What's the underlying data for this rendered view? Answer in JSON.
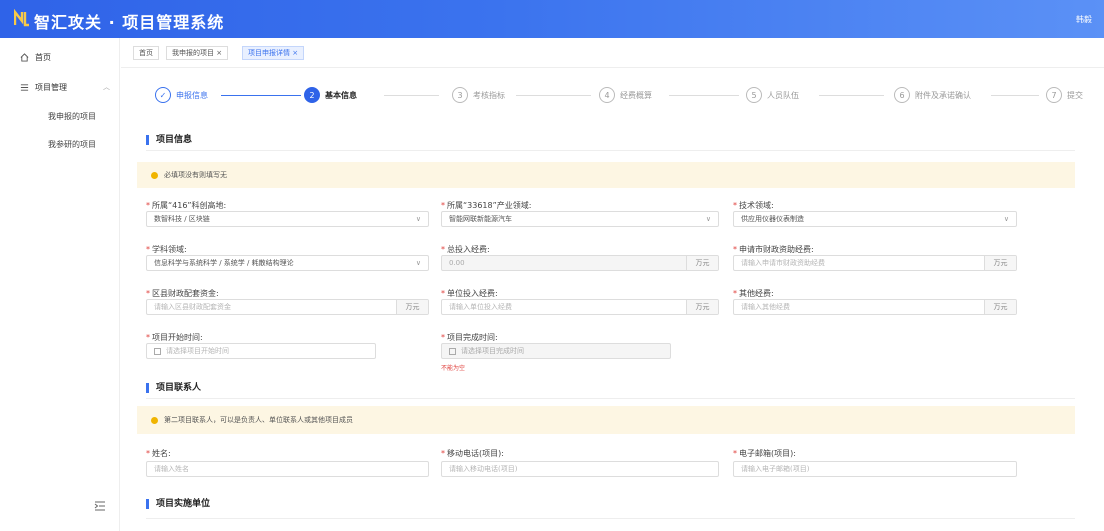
{
  "header": {
    "title": "智汇攻关 · 项目管理系统",
    "user": "韩毅"
  },
  "sidebar": {
    "home": "首页",
    "group": "项目管理",
    "items": [
      "我申报的项目",
      "我参研的项目"
    ]
  },
  "tabs": [
    {
      "label": "首页"
    },
    {
      "label": "我申报的项目 ×"
    },
    {
      "label": "项目申报详情 ×"
    }
  ],
  "steps": [
    {
      "num": "✓",
      "label": "申报信息"
    },
    {
      "num": "2",
      "label": "基本信息"
    },
    {
      "num": "3",
      "label": "考核指标"
    },
    {
      "num": "4",
      "label": "经费概算"
    },
    {
      "num": "5",
      "label": "人员队伍"
    },
    {
      "num": "6",
      "label": "附件及承诺确认"
    },
    {
      "num": "7",
      "label": "提交"
    }
  ],
  "sections": {
    "project_info": {
      "title": "项目信息",
      "notice": "必填项没有则填写无",
      "fields": {
        "f416": {
          "label": "所属“416”科创高地:",
          "value": "数智科技 / 区块链"
        },
        "f33618": {
          "label": "所属“33618”产业领域:",
          "value": "智能网联新能源汽车"
        },
        "tech": {
          "label": "技术领域:",
          "value": "供应用仪器仪表制造"
        },
        "subject": {
          "label": "学科领域:",
          "value": "信息科学与系统科学 / 系统学 / 耗散结构理论"
        },
        "total": {
          "label": "总投入经费:",
          "value": "0.00",
          "unit": "万元"
        },
        "city": {
          "label": "申请市财政资助经费:",
          "placeholder": "请输入申请市财政资助经费",
          "unit": "万元"
        },
        "district": {
          "label": "区县财政配套资金:",
          "placeholder": "请输入区县财政配套资金",
          "unit": "万元"
        },
        "unit_fund": {
          "label": "单位投入经费:",
          "placeholder": "请输入单位投入经费",
          "unit": "万元"
        },
        "other": {
          "label": "其他经费:",
          "placeholder": "请输入其他经费",
          "unit": "万元"
        },
        "start": {
          "label": "项目开始时间:",
          "placeholder": "请选择项目开始时间"
        },
        "end": {
          "label": "项目完成时间:",
          "placeholder": "请选择项目完成时间",
          "error": "不能为空"
        }
      }
    },
    "contact": {
      "title": "项目联系人",
      "notice": "第二项目联系人，可以是负责人、单位联系人或其他项目成员",
      "fields": {
        "name": {
          "label": "姓名:",
          "placeholder": "请输入姓名"
        },
        "phone": {
          "label": "移动电话(项目):",
          "placeholder": "请输入移动电话(项目)"
        },
        "email": {
          "label": "电子邮箱(项目):",
          "placeholder": "请输入电子邮箱(项目)"
        }
      }
    },
    "unit": {
      "title": "项目实施单位"
    }
  }
}
